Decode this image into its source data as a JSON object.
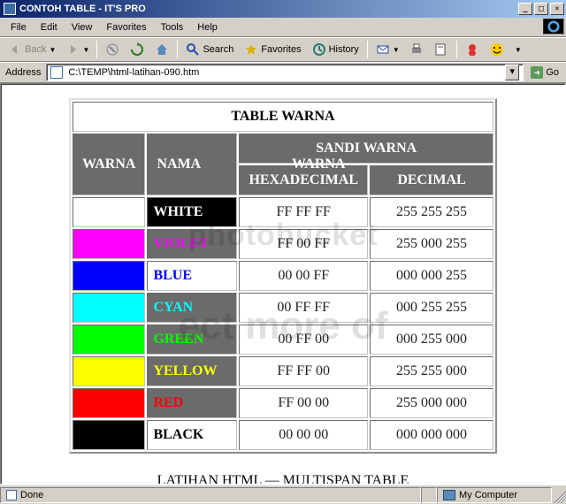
{
  "window": {
    "title": "CONTOH TABLE - IT'S PRO"
  },
  "menu": {
    "items": [
      "File",
      "Edit",
      "View",
      "Favorites",
      "Tools",
      "Help"
    ]
  },
  "toolbar": {
    "back": "Back",
    "search": "Search",
    "favorites": "Favorites",
    "history": "History"
  },
  "address": {
    "label": "Address",
    "value": "C:\\TEMP\\html-latihan-090.htm",
    "go": "Go"
  },
  "page": {
    "table_title": "TABLE WARNA",
    "col_warna": "WARNA",
    "col_nama": "NAMA WARNA",
    "col_sandi": "SANDI WARNA",
    "col_hex": "HEXADECIMAL",
    "col_dec": "DECIMAL",
    "rows": [
      {
        "swatch": "#FFFFFF",
        "name": "WHITE",
        "name_bg": "#000000",
        "name_fg": "#FFFFFF",
        "hex": "FF FF FF",
        "dec": "255 255 255"
      },
      {
        "swatch": "#FF00FF",
        "name": "VIOLET",
        "name_bg": "#6b6b6b",
        "name_fg": "#FF00FF",
        "hex": "FF 00 FF",
        "dec": "255  000 255"
      },
      {
        "swatch": "#0000FF",
        "name": "BLUE",
        "name_bg": "#FFFFFF",
        "name_fg": "#0000FF",
        "hex": "00 00 FF",
        "dec": "000 000 255"
      },
      {
        "swatch": "#00FFFF",
        "name": "CYAN",
        "name_bg": "#6b6b6b",
        "name_fg": "#00FFFF",
        "hex": "00 FF FF",
        "dec": "000 255 255"
      },
      {
        "swatch": "#00FF00",
        "name": "GREEN",
        "name_bg": "#6b6b6b",
        "name_fg": "#00FF00",
        "hex": "00 FF 00",
        "dec": "000 255 000"
      },
      {
        "swatch": "#FFFF00",
        "name": "YELLOW",
        "name_bg": "#6b6b6b",
        "name_fg": "#FFFF00",
        "hex": "FF FF 00",
        "dec": "255 255 000"
      },
      {
        "swatch": "#FF0000",
        "name": "RED",
        "name_bg": "#6b6b6b",
        "name_fg": "#FF0000",
        "hex": "FF 00 00",
        "dec": "255 000 000"
      },
      {
        "swatch": "#000000",
        "name": "BLACK",
        "name_bg": "#FFFFFF",
        "name_fg": "#000000",
        "hex": "00 00 00",
        "dec": "000 000 000"
      }
    ],
    "caption": "LATIHAN HTML — MULTISPAN TABLE"
  },
  "watermark": {
    "logo": "photobucket",
    "sub": "ect more of"
  },
  "status": {
    "left": "Done",
    "right": "My Computer"
  }
}
